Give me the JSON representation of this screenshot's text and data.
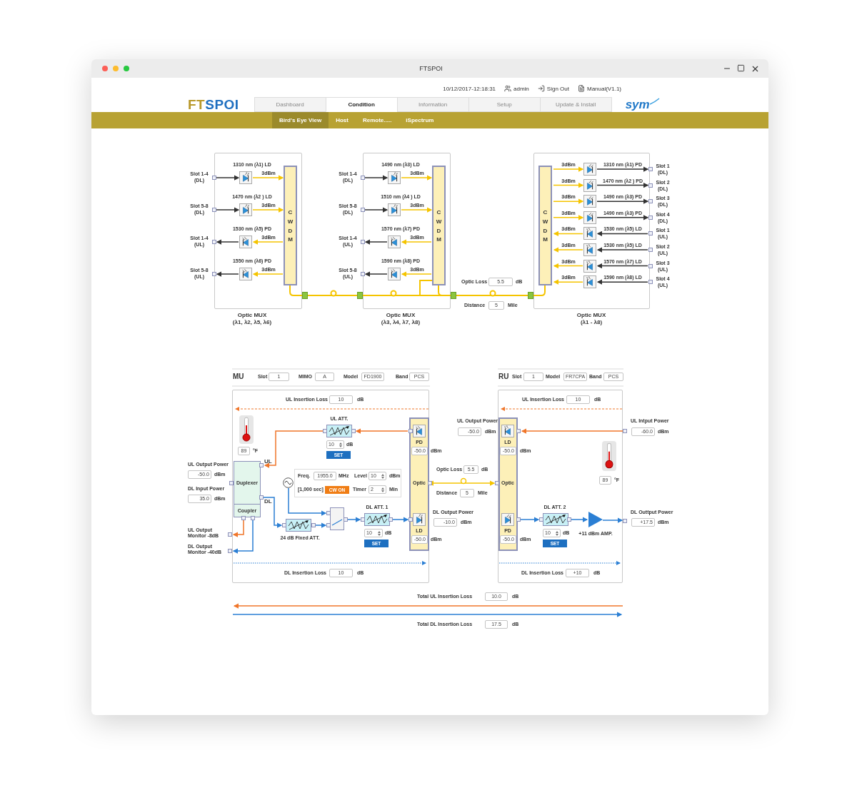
{
  "window": {
    "title": "FTSPOI"
  },
  "header": {
    "datetime": "10/12/2017-12:18:31",
    "user": "admin",
    "sign_out": "Sign Out",
    "manual": "Manual(V1.1)",
    "logo_part_1": "FT",
    "logo_part_2": "SPOI",
    "brand": "sym"
  },
  "tabs": [
    {
      "label": "Dashboard",
      "selected": false
    },
    {
      "label": "Condition",
      "selected": true
    },
    {
      "label": "Information",
      "selected": false
    },
    {
      "label": "Setup",
      "selected": false
    },
    {
      "label": "Update & Install",
      "selected": false
    }
  ],
  "subtabs": [
    {
      "label": "Bird's Eye View",
      "selected": true
    },
    {
      "label": "Host",
      "selected": false
    },
    {
      "label": "Remote.....",
      "selected": false
    },
    {
      "label": "iSpectrum",
      "selected": false
    }
  ],
  "optic_mux": [
    {
      "title": "Optic MUX",
      "subtitle": "(λ1, λ2, λ5, λ6)",
      "cwdm": "CWDM",
      "channels": [
        {
          "slot": "Slot 1-4",
          "link": "(DL)",
          "label": "1310 nm (λ1) LD",
          "power": "3dBm",
          "kind": "ld",
          "downlink": true
        },
        {
          "slot": "Slot 5-8",
          "link": "(DL)",
          "label": "1470 nm (λ2 ) LD",
          "power": "3dBm",
          "kind": "ld",
          "downlink": true
        },
        {
          "slot": "Slot 1-4",
          "link": "(UL)",
          "label": "1530 nm (λ5) PD",
          "power": "3dBm",
          "kind": "pd",
          "downlink": false
        },
        {
          "slot": "Slot 5-8",
          "link": "(UL)",
          "label": "1550 nm (λ6) PD",
          "power": "3dBm",
          "kind": "pd",
          "downlink": false
        }
      ]
    },
    {
      "title": "Optic MUX",
      "subtitle": "(λ3, λ4, λ7, λ8)",
      "cwdm": "CWDM",
      "channels": [
        {
          "slot": "Slot 1-4",
          "link": "(DL)",
          "label": "1490 nm (λ3) LD",
          "power": "3dBm",
          "kind": "ld",
          "downlink": true
        },
        {
          "slot": "Slot 5-8",
          "link": "(DL)",
          "label": "1510 nm (λ4 ) LD",
          "power": "3dBm",
          "kind": "ld",
          "downlink": true
        },
        {
          "slot": "Slot 1-4",
          "link": "(UL)",
          "label": "1570 nm (λ7) PD",
          "power": "3dBm",
          "kind": "pd",
          "downlink": false
        },
        {
          "slot": "Slot 5-8",
          "link": "(UL)",
          "label": "1590 nm (λ8) PD",
          "power": "3dBm",
          "kind": "pd",
          "downlink": false
        }
      ]
    },
    {
      "title": "Optic MUX",
      "subtitle": "(λ1 - λ8)",
      "cwdm": "CWDM",
      "channels": [
        {
          "slot": "Slot 1",
          "link": "(DL)",
          "label": "1310 nm (λ1) PD",
          "power": "3dBm",
          "kind": "pd",
          "downlink": true
        },
        {
          "slot": "Slot 2",
          "link": "(DL)",
          "label": "1470 nm (λ2 ) PD",
          "power": "3dBm",
          "kind": "pd",
          "downlink": true
        },
        {
          "slot": "Slot 3",
          "link": "(DL)",
          "label": "1490 nm (λ3) PD",
          "power": "3dBm",
          "kind": "pd",
          "downlink": true
        },
        {
          "slot": "Slot 4",
          "link": "(DL)",
          "label": "1490 nm (λ3) PD",
          "power": "3dBm",
          "kind": "pd",
          "downlink": true
        },
        {
          "slot": "Slot 1",
          "link": "(UL)",
          "label": "1530 nm (λ5) LD",
          "power": "3dBm",
          "kind": "ld",
          "downlink": false
        },
        {
          "slot": "Slot 2",
          "link": "(UL)",
          "label": "1530 nm (λ5) LD",
          "power": "3dBm",
          "kind": "ld",
          "downlink": false
        },
        {
          "slot": "Slot 3",
          "link": "(UL)",
          "label": "1570 nm (λ7) LD",
          "power": "3dBm",
          "kind": "ld",
          "downlink": false
        },
        {
          "slot": "Slot 4",
          "link": "(UL)",
          "label": "1590 nm (λ8) LD",
          "power": "3dBm",
          "kind": "ld",
          "downlink": false
        }
      ]
    }
  ],
  "fiber": {
    "optic_loss": {
      "label": "Optic Loss",
      "value": "5.5",
      "unit": "dB"
    },
    "distance": {
      "label": "Distance",
      "value": "5",
      "unit": "Mile"
    }
  },
  "mu": {
    "title": "MU",
    "settings": [
      {
        "label": "Slot",
        "value": "1"
      },
      {
        "label": "MIMO",
        "value": "A"
      },
      {
        "label": "Model",
        "value": "FD1900"
      },
      {
        "label": "Band",
        "value": "PCS"
      }
    ],
    "ul_insertion_loss": {
      "label": "UL Insertion Loss",
      "value": "10",
      "unit": "dB"
    },
    "temperature": {
      "value": "89",
      "unit": "°F"
    },
    "ul_att": {
      "label": "UL ATT.",
      "value": "10",
      "unit": "dB",
      "button": "SET"
    },
    "pd": {
      "label": "PD",
      "value": "-50.0",
      "unit": "dBm"
    },
    "optic": "Optic",
    "ld": {
      "label": "LD",
      "value": "-50.0",
      "unit": "dBm"
    },
    "duplexer": "Duplexer",
    "coupler": "Coupler",
    "ul": "UL",
    "dl": "DL",
    "ul_output_power": {
      "label": "UL Output Power",
      "value": "-50.0",
      "unit": "dBm"
    },
    "dl_input_power": {
      "label": "DL Input Power",
      "value": "35.0",
      "unit": "dBm"
    },
    "ul_monitor": "UL Output Monitor -8dB",
    "dl_monitor": "DL Output Monitor -40dB",
    "generator": {
      "freq_label": "Freq.",
      "freq": "1955.0",
      "freq_unit": "MHz",
      "level_label": "Level",
      "level_value": "10",
      "level_unit": "dBm",
      "duration": "[1,000 sec]",
      "button": "CW ON",
      "timer_label": "Timer",
      "timer": "2",
      "timer_unit": "Min"
    },
    "fixed_att": "24 dB Fixed ATT.",
    "dl_att": {
      "label": "DL ATT. 1",
      "value": "10",
      "unit": "dB",
      "button": "SET"
    },
    "dl_insertion_loss": {
      "label": "DL Insertion Loss",
      "value": "10",
      "unit": "dB"
    }
  },
  "link": {
    "optic_loss": {
      "label": "Optic Loss",
      "value": "5.5",
      "unit": "dB"
    },
    "distance": {
      "label": "Distance",
      "value": "5",
      "unit": "Mile"
    },
    "ul_output_power": {
      "label": "UL Output Power",
      "value": "-50.0",
      "unit": "dBm"
    },
    "dl_output_power": {
      "label": "DL Output Power",
      "value": "-10.0",
      "unit": "dBm"
    }
  },
  "ru": {
    "title": "RU",
    "settings": [
      {
        "label": "Slot",
        "value": "1"
      },
      {
        "label": "Model",
        "value": "FR7CPA"
      },
      {
        "label": "Band",
        "value": "PCS"
      }
    ],
    "ul_insertion_loss": {
      "label": "UL Insertion Loss",
      "value": "10",
      "unit": "dB"
    },
    "ld": {
      "label": "LD",
      "value": "-50.0",
      "unit": "dBm"
    },
    "optic": "Optic",
    "pd": {
      "label": "PD",
      "value": "-50.0",
      "unit": "dBm"
    },
    "ul_input_power": {
      "label": "UL Intput Power",
      "value": "-60.0",
      "unit": "dBm"
    },
    "temperature": {
      "value": "89",
      "unit": "°F"
    },
    "dl_att": {
      "label": "DL ATT. 2",
      "value": "10",
      "unit": "dB",
      "button": "SET"
    },
    "amp": "+11 dBm AMP.",
    "dl_output_power": {
      "label": "DL Outtput Power",
      "value": "+17.5",
      "unit": "dBm"
    },
    "dl_insertion_loss": {
      "label": "DL Insertion Loss",
      "value": "+10",
      "unit": "dB"
    }
  },
  "totals": [
    {
      "label": "Total UL Insertion Loss",
      "value": "10.0",
      "unit": "dB"
    },
    {
      "label": "Total DL Insertion Loss",
      "value": "17.5",
      "unit": "dB"
    }
  ]
}
